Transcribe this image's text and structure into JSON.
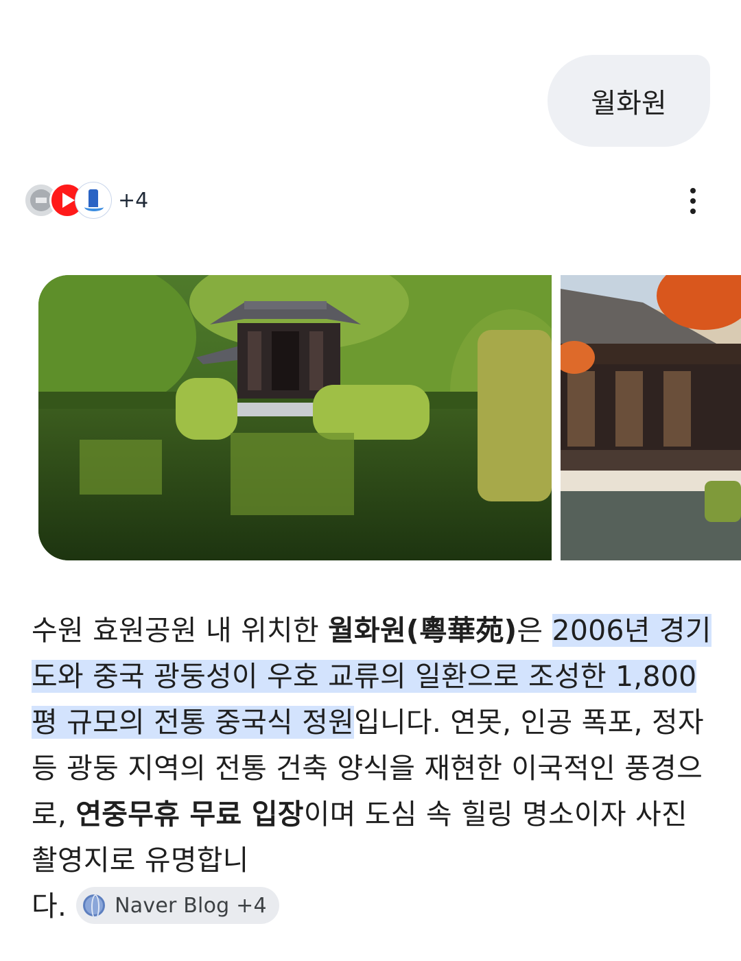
{
  "user_query": "월화원",
  "sources": {
    "icons": [
      "globe-grey-icon",
      "youtube-icon",
      "lighthouse-icon"
    ],
    "more_label": "+4"
  },
  "answer": {
    "p1": "수원 효원공원 내 위치한 ",
    "b1": "월화원(粵華苑)",
    "p2": "은 ",
    "hl": "2006년 경기도와 중국 광둥성이 우호 교류의 일환으로 조성한 1,800평 규모의 전통 중국식 정원",
    "p3": "입니다. 연못, 인공 폭포, 정자 등 광둥 지역의 전통 건축 양식을 재현한 이국적인 풍경으로, ",
    "b2": "연중무휴 무료 입장",
    "p4": "이며 도심 속 힐링 명소이자 사진 촬영지로 유명합니",
    "p5": "다."
  },
  "citation_chip": {
    "label": "Naver Blog +4"
  }
}
